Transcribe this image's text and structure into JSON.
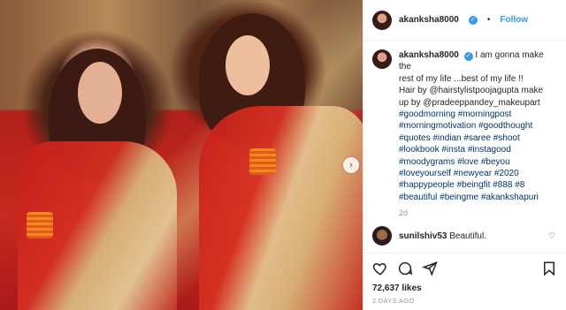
{
  "header": {
    "username": "akanksha8000",
    "follow_label": "Follow",
    "separator": "•"
  },
  "caption": {
    "username": "akanksha8000",
    "text_lines": [
      "I am gonna make the",
      "rest of my life ...best of my life !!",
      "Hair by @hairstylistpoojagupta make",
      "up by @pradeeppandey_makeupart",
      "#goodmorning #morningpost",
      "#morningmotivation #goodthought",
      "#quotes #indian #saree #shoot",
      "#lookbook #insta #instagood",
      "#moodygrams #love #beyou",
      "#loveyourself #newyear #2020",
      "#happypeople #beingfit #888 #8",
      "#beautiful #beingme #akankshapuri"
    ],
    "age": "2d"
  },
  "comment": {
    "username": "sunilshiv53",
    "text": "Beautiful."
  },
  "stats": {
    "likes": "72,637 likes",
    "posted": "2 DAYS AGO"
  },
  "icons": {
    "verified": "verified-badge-icon",
    "next": "chevron-right-icon",
    "like": "heart-icon",
    "comment": "comment-bubble-icon",
    "share": "paper-plane-icon",
    "save": "bookmark-icon",
    "comment_like": "small-heart-icon"
  },
  "colors": {
    "link": "#3897f0",
    "hashtag": "#003569",
    "muted": "#999999",
    "text": "#262626"
  }
}
